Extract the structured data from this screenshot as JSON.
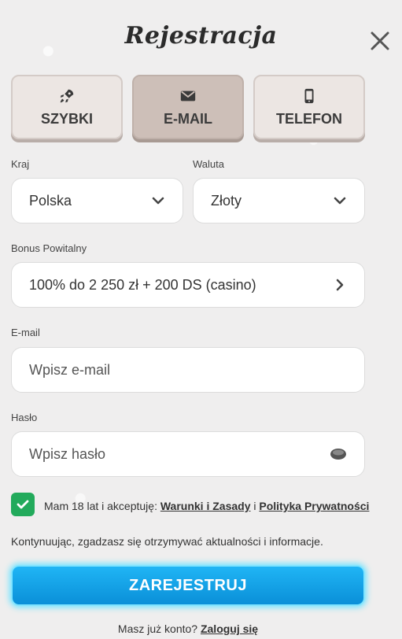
{
  "header": {
    "title": "Rejestracja"
  },
  "tabs": [
    {
      "label": "SZYBKI",
      "icon": "rocket-icon",
      "active": false
    },
    {
      "label": "E-MAIL",
      "icon": "envelope-icon",
      "active": true
    },
    {
      "label": "TELEFON",
      "icon": "phone-icon",
      "active": false
    }
  ],
  "form": {
    "country": {
      "label": "Kraj",
      "value": "Polska"
    },
    "currency": {
      "label": "Waluta",
      "value": "Złoty"
    },
    "bonus": {
      "label": "Bonus Powitalny",
      "value": "100% do 2 250 zł + 200 DS (casino)"
    },
    "email": {
      "label": "E-mail",
      "placeholder": "Wpisz e-mail"
    },
    "password": {
      "label": "Hasło",
      "placeholder": "Wpisz hasło"
    }
  },
  "terms": {
    "prefix": "Mam 18 lat i akceptuję: ",
    "link1": "Warunki i Zasady",
    "between": " i ",
    "link2": "Polityka Prywatności",
    "checked": true
  },
  "info_text": "Kontynuując, zgadzasz się otrzymywać aktualności i informacje.",
  "submit_label": "ZAREJESTRUJ",
  "login": {
    "prompt": "Masz już konto? ",
    "link": "Zaloguj się"
  },
  "colors": {
    "accent": "#1aa7ec",
    "check": "#22aa5b",
    "tab_active": "#cdbfb8"
  }
}
